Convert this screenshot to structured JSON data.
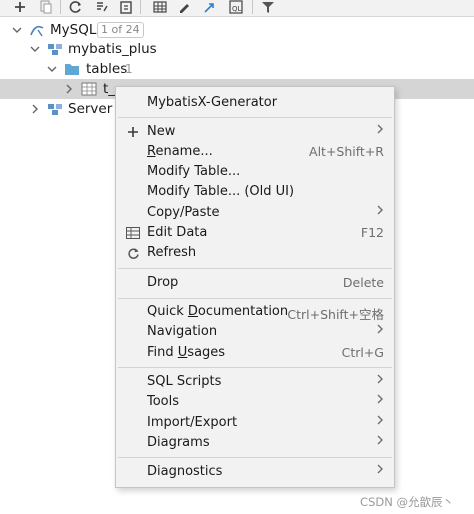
{
  "toolbar": {
    "icons": [
      "add-icon",
      "copy-icon",
      "refresh-icon",
      "schema-icon",
      "stop-icon",
      "table-icon",
      "edit-icon",
      "jump-icon",
      "console-icon",
      "filter-icon"
    ]
  },
  "tree": {
    "datasource": {
      "label": "MySQL",
      "badge": "1 of 24"
    },
    "schema": {
      "label": "mybatis_plus"
    },
    "tables_folder": {
      "label": "tables",
      "count": "1"
    },
    "table_item": {
      "label": "t_"
    },
    "server_objects": {
      "label": "Server O"
    }
  },
  "menu": {
    "generator": "MybatisX-Generator",
    "new": "New",
    "rename_prefix": "R",
    "rename_rest": "ename...",
    "rename_shortcut": "Alt+Shift+R",
    "modify_table": "Modify Table...",
    "modify_table_old": "Modify Table... (Old UI)",
    "copy_paste": "Copy/Paste",
    "edit_data": "Edit Data",
    "edit_data_shortcut": "F12",
    "refresh": "Refresh",
    "drop": "Drop",
    "drop_shortcut": "Delete",
    "quick_doc_prefix": "Quick ",
    "quick_doc_u": "D",
    "quick_doc_rest": "ocumentation",
    "quick_doc_shortcut": "Ctrl+Shift+空格",
    "navigation": "Navigation",
    "find_usages_prefix": "Find ",
    "find_usages_u": "U",
    "find_usages_rest": "sages",
    "find_usages_shortcut": "Ctrl+G",
    "sql_scripts": "SQL Scripts",
    "tools": "Tools",
    "import_export": "Import/Export",
    "diagrams": "Diagrams",
    "diagnostics": "Diagnostics"
  },
  "watermark": "CSDN @允歆辰丶",
  "colors": {
    "menu_bg": "#f2f2f2",
    "selected_row": "#d5d5d5",
    "folder_blue": "#5fa8d3",
    "datasource_blue": "#4a7fc1"
  }
}
